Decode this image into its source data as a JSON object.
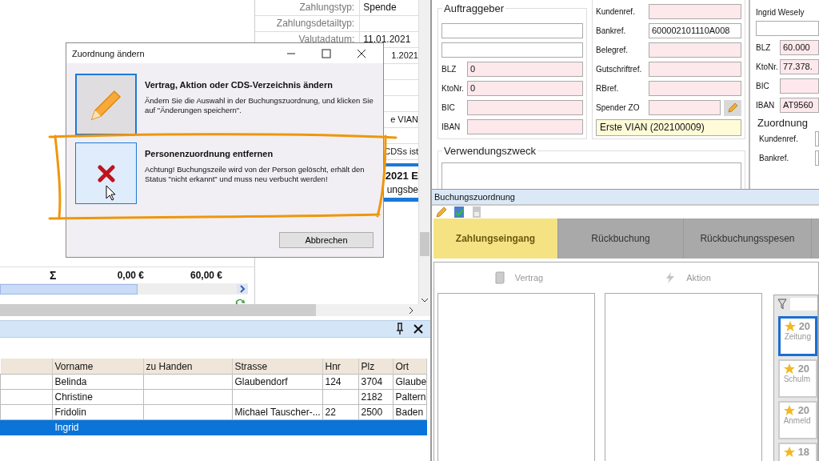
{
  "details": {
    "rows": [
      {
        "label": "Zahlungstyp:",
        "value": "Spende"
      },
      {
        "label": "Zahlungsdetailtyp:"
      },
      {
        "label": "Valutadatum:",
        "value": "11.01.2021"
      },
      {
        "value": "1.2021"
      },
      {},
      {},
      {},
      {
        "value": "e VIAN"
      },
      {},
      {
        "value": "CDSs ist"
      }
    ],
    "notice": {
      "title": "2021 E",
      "text": "ungsbe"
    }
  },
  "totals": {
    "symbol": "Σ",
    "values": [
      "0,00 €",
      "60,00 €"
    ]
  },
  "person_table": {
    "columns": [
      "Vorname",
      "zu Handen",
      "Strasse",
      "Hnr",
      "Plz",
      "Ort"
    ],
    "rows": [
      {
        "cells": [
          "Belinda",
          null,
          "Glaubendorf",
          "124",
          "3704",
          "Glaube"
        ],
        "selected": false
      },
      {
        "cells": [
          "Christine",
          null,
          null,
          null,
          "2182",
          "Paltern"
        ],
        "selected": false
      },
      {
        "cells": [
          "Fridolin",
          null,
          "Michael Tauscher-...",
          "22",
          "2500",
          "Baden"
        ],
        "selected": false
      },
      {
        "cells": [
          "Ingrid",
          null,
          null,
          null,
          null,
          null
        ],
        "selected": true
      }
    ]
  },
  "payer": {
    "title": "Auftraggeber",
    "fields": [
      {
        "kind": "blank",
        "highlighted": false
      },
      {
        "kind": "blank",
        "highlighted": false
      },
      {
        "kind": "text",
        "label": "BLZ",
        "value": "0",
        "highlighted": true
      },
      {
        "kind": "text",
        "label": "KtoNr.",
        "value": "0",
        "highlighted": true
      },
      {
        "kind": "text",
        "label": "BIC",
        "highlighted": true
      },
      {
        "kind": "text",
        "label": "IBAN",
        "highlighted": true
      }
    ]
  },
  "assignment": {
    "fields": [
      {
        "kind": "text",
        "label": "Kundenref.",
        "highlighted": true
      },
      {
        "kind": "text",
        "label": "Bankref.",
        "value": "600002101110A008",
        "highlighted": false
      },
      {
        "kind": "text",
        "label": "Belegref.",
        "highlighted": true
      },
      {
        "kind": "text",
        "label": "Gutschriftref.",
        "highlighted": true
      },
      {
        "kind": "text",
        "label": "RBref.",
        "highlighted": true
      },
      {
        "kind": "lookup",
        "label": "Spender ZO",
        "highlighted": true
      }
    ],
    "result": "Erste VIAN (202100009)"
  },
  "purpose": {
    "title": "Verwendungszweck"
  },
  "counterparty": {
    "name": "Ingrid Wesely",
    "fields": [
      {
        "kind": "blank",
        "highlighted": false
      },
      {
        "kind": "text",
        "label": "BLZ",
        "value": "60.000",
        "highlighted": true
      },
      {
        "kind": "text",
        "label": "KtoNr.",
        "value": "77.378.",
        "highlighted": true
      },
      {
        "kind": "text",
        "label": "BIC",
        "highlighted": true
      },
      {
        "kind": "text",
        "label": "IBAN",
        "value": "AT9560",
        "highlighted": true
      }
    ],
    "assignment_title": "Zuordnung",
    "assignment_labels": [
      "Kundenref.",
      "Bankref."
    ]
  },
  "booking_assignment": {
    "title": "Buchungszuordnung",
    "tabs": [
      {
        "label": "Zahlungseingang",
        "selected": true
      },
      {
        "label": "Rückbuchung",
        "selected": false
      },
      {
        "label": "Rückbuchungsspesen",
        "selected": false
      }
    ],
    "sections": [
      {
        "kind": "contract",
        "label": "Vertrag"
      },
      {
        "kind": "campaign",
        "label": "Aktion"
      }
    ],
    "cards": [
      {
        "year": "20",
        "name": "Zeitung",
        "selected": true
      },
      {
        "year": "20",
        "name": "Schulm",
        "selected": false
      },
      {
        "year": "20",
        "name": "Anmeld",
        "selected": false
      },
      {
        "year": "18",
        "selected": false
      }
    ]
  },
  "dialog": {
    "title": "Zuordnung ändern",
    "options": [
      {
        "kind": "edit",
        "title": "Vertrag, Aktion oder CDS-Verzeichnis ändern",
        "text": "Ändern Sie die Auswahl in der Buchungszuordnung, und klicken Sie auf \"Änderungen speichern\".",
        "selected": false
      },
      {
        "kind": "remove",
        "title": "Personenzuordnung entfernen",
        "text": "Achtung! Buchungszeile wird von der Person gelöscht, erhält den Status \"nicht erkannt\" und muss neu verbucht werden!",
        "selected": true
      }
    ],
    "cancel": "Abbrechen"
  }
}
